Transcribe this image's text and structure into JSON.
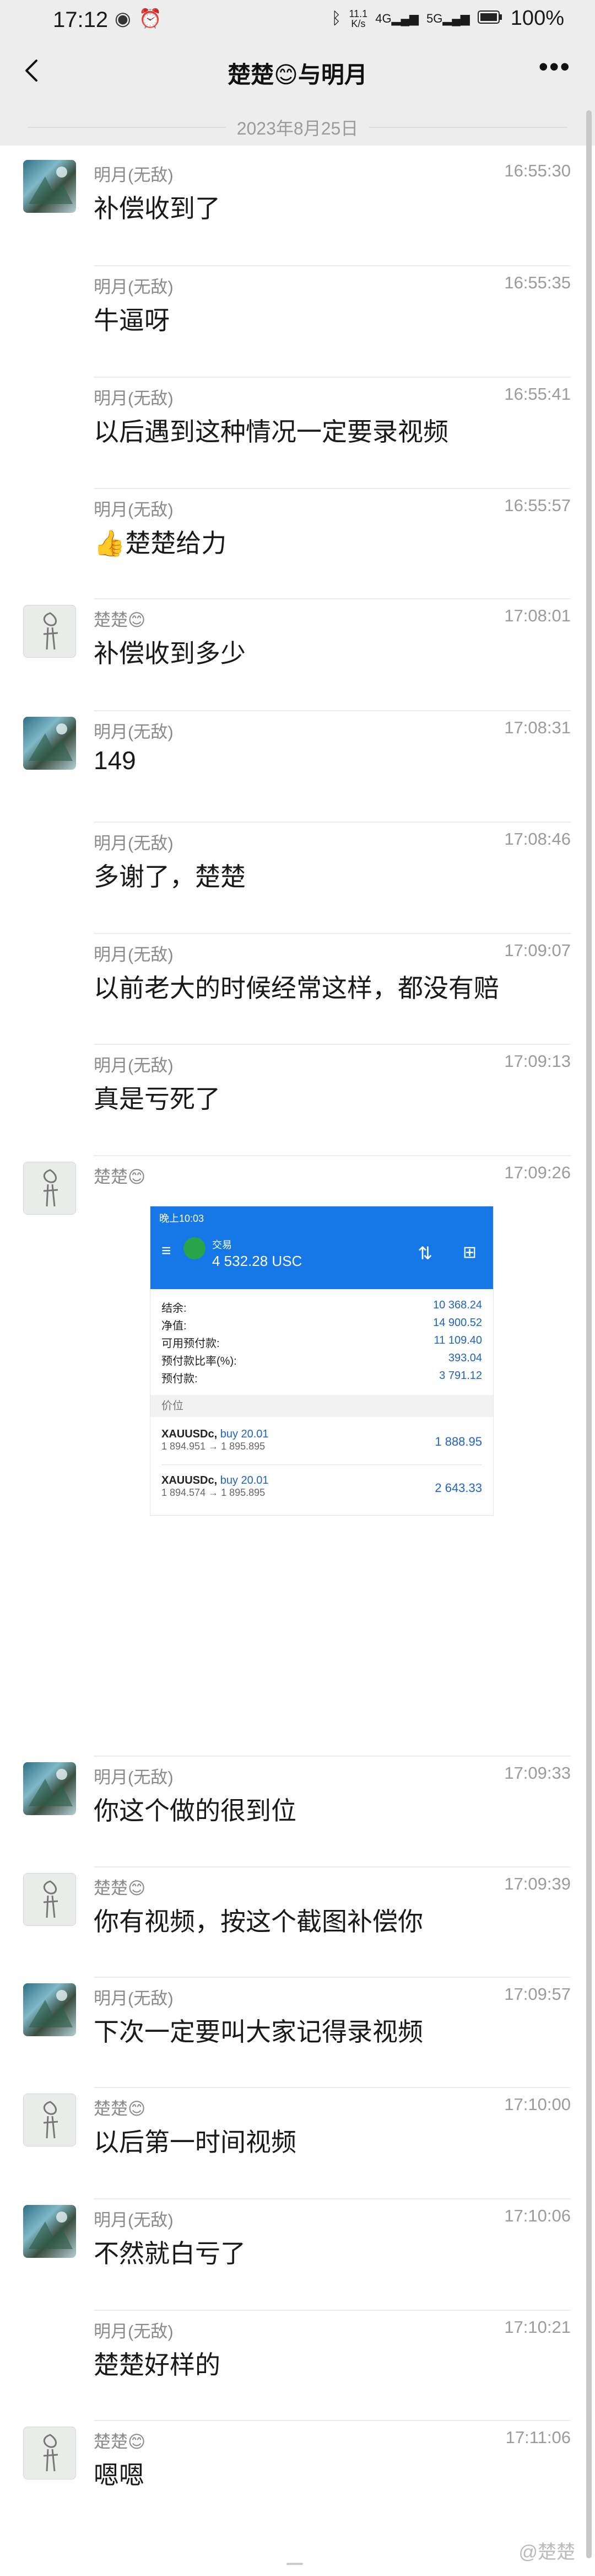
{
  "status_bar": {
    "time": "17:12",
    "left_icons": [
      "eye-icon",
      "alarm-icon"
    ],
    "net_speed_top": "11.1",
    "net_speed_bottom": "K/s",
    "signal1": "4G",
    "signal2": "5G",
    "battery": "100%"
  },
  "header": {
    "title": "楚楚😊与明月",
    "more": "•••"
  },
  "date_divider": "2023年8月25日",
  "messages": [
    {
      "sender": "明月(无敌)",
      "time": "16:55:30",
      "text": "补偿收到了",
      "avatar": "a",
      "show_avatar": true
    },
    {
      "sender": "明月(无敌)",
      "time": "16:55:35",
      "text": "牛逼呀",
      "avatar": "a",
      "show_avatar": false
    },
    {
      "sender": "明月(无敌)",
      "time": "16:55:41",
      "text": "以后遇到这种情况一定要录视频",
      "avatar": "a",
      "show_avatar": false
    },
    {
      "sender": "明月(无敌)",
      "time": "16:55:57",
      "text": "👍楚楚给力",
      "avatar": "a",
      "show_avatar": false
    },
    {
      "sender": "楚楚😊",
      "time": "17:08:01",
      "text": "补偿收到多少",
      "avatar": "b",
      "show_avatar": true
    },
    {
      "sender": "明月(无敌)",
      "time": "17:08:31",
      "text": "149",
      "avatar": "a",
      "show_avatar": true
    },
    {
      "sender": "明月(无敌)",
      "time": "17:08:46",
      "text": "多谢了，楚楚",
      "avatar": "a",
      "show_avatar": false
    },
    {
      "sender": "明月(无敌)",
      "time": "17:09:07",
      "text": "以前老大的时候经常这样，都没有赔",
      "avatar": "a",
      "show_avatar": false
    },
    {
      "sender": "明月(无敌)",
      "time": "17:09:13",
      "text": "真是亏死了",
      "avatar": "a",
      "show_avatar": false
    },
    {
      "sender": "楚楚😊",
      "time": "17:09:26",
      "text": "",
      "avatar": "b",
      "show_avatar": true,
      "image": true
    },
    {
      "sender": "明月(无敌)",
      "time": "17:09:33",
      "text": "你这个做的很到位",
      "avatar": "a",
      "show_avatar": true
    },
    {
      "sender": "楚楚😊",
      "time": "17:09:39",
      "text": "你有视频，按这个截图补偿你",
      "avatar": "b",
      "show_avatar": true
    },
    {
      "sender": "明月(无敌)",
      "time": "17:09:57",
      "text": "下次一定要叫大家记得录视频",
      "avatar": "a",
      "show_avatar": true
    },
    {
      "sender": "楚楚😊",
      "time": "17:10:00",
      "text": "以后第一时间视频",
      "avatar": "b",
      "show_avatar": true
    },
    {
      "sender": "明月(无敌)",
      "time": "17:10:06",
      "text": "不然就白亏了",
      "avatar": "a",
      "show_avatar": true
    },
    {
      "sender": "明月(无敌)",
      "time": "17:10:21",
      "text": "楚楚好样的",
      "avatar": "a",
      "show_avatar": false
    },
    {
      "sender": "楚楚😊",
      "time": "17:11:06",
      "text": "嗯嗯",
      "avatar": "b",
      "show_avatar": true
    }
  ],
  "screenshot": {
    "status_time": "晚上10:03",
    "tab_label": "交易",
    "balance_header": "4 532.28 USC",
    "rows": [
      {
        "label": "结余:",
        "value": "10 368.24"
      },
      {
        "label": "净值:",
        "value": "14 900.52"
      },
      {
        "label": "可用预付款:",
        "value": "11 109.40"
      },
      {
        "label": "预付款比率(%):",
        "value": "393.04"
      },
      {
        "label": "预付款:",
        "value": "3 791.12"
      }
    ],
    "section_label": "价位",
    "trades": [
      {
        "symbol": "XAUUSDc,",
        "action": "buy 20.01",
        "prices": "1 894.951 → 1 895.895",
        "profit": "1 888.95"
      },
      {
        "symbol": "XAUUSDc,",
        "action": "buy 20.01",
        "prices": "1 894.574 → 1 895.895",
        "profit": "2 643.33"
      }
    ]
  },
  "watermark": "@楚楚",
  "colors": {
    "chrome_bg": "#ededed",
    "accent_blue": "#1677e6",
    "text_gray": "#8a8a8a"
  }
}
